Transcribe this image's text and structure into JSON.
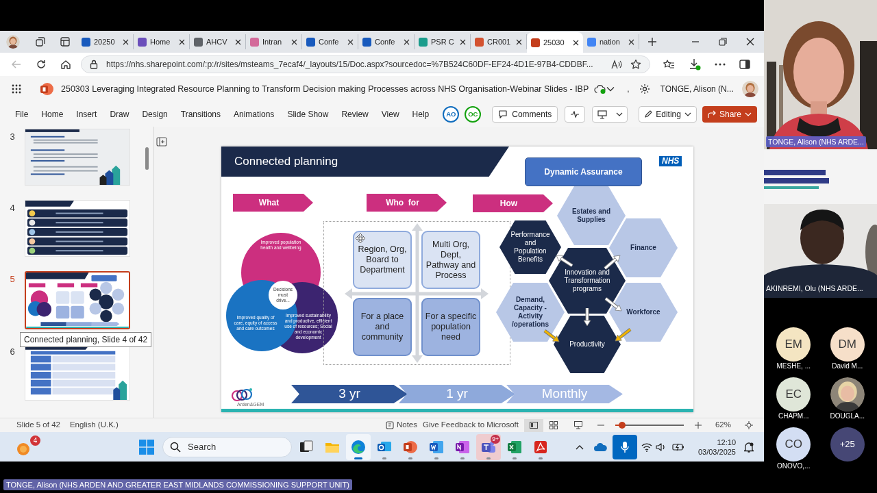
{
  "browser": {
    "tabs": [
      {
        "label": "20250",
        "color": "#185abd",
        "selected": false
      },
      {
        "label": "Home",
        "color": "#6b4fbb",
        "selected": false
      },
      {
        "label": "AHCV",
        "color": "#5f6368",
        "selected": false
      },
      {
        "label": "Intran",
        "color": "#d36a9a",
        "selected": false
      },
      {
        "label": "Confe",
        "color": "#185abd",
        "selected": false
      },
      {
        "label": "Confe",
        "color": "#185abd",
        "selected": false
      },
      {
        "label": "PSR C",
        "color": "#1a9c8c",
        "selected": false
      },
      {
        "label": "CR001",
        "color": "#d35230",
        "selected": false
      },
      {
        "label": "25030",
        "color": "#c43e1c",
        "selected": true
      },
      {
        "label": "nation",
        "color": "#4285f4",
        "selected": false
      }
    ],
    "url": "https://nhs.sharepoint.com/:p:/r/sites/msteams_7ecaf4/_layouts/15/Doc.aspx?sourcedoc=%7B524C60DF-EF24-4D1E-97B4-CDDBF..."
  },
  "app": {
    "document_title": "250303 Leveraging Integrated Resource Planning to Transform  Decision making Processes across NHS Organisation-Webinar Slides - IBP",
    "separator": ",",
    "user_name": "TONGE, Alison (N...",
    "menu": [
      "File",
      "Home",
      "Insert",
      "Draw",
      "Design",
      "Transitions",
      "Animations",
      "Slide Show",
      "Review",
      "View",
      "Help"
    ],
    "coauthors": [
      {
        "initials": "AO",
        "color": "#0f6cbd"
      },
      {
        "initials": "OC",
        "color": "#13a10e"
      }
    ],
    "comments_button": "Comments",
    "editing_button": "Editing",
    "share_button": "Share"
  },
  "thumbnails": [
    {
      "number": "3",
      "kind": "text",
      "selected": false
    },
    {
      "number": "4",
      "kind": "rows",
      "selected": false
    },
    {
      "number": "5",
      "kind": "diagram",
      "selected": true
    },
    {
      "number": "6",
      "kind": "table",
      "selected": false
    }
  ],
  "tooltip": "Connected planning, Slide 4 of 42",
  "slide": {
    "title": "Connected planning",
    "assurance": "Dynamic Assurance",
    "nhs_logo": "NHS",
    "banners": [
      "What",
      "Who  for",
      "How"
    ],
    "venn": [
      "Improved population health and wellbeing",
      "Improved quality of care, equity of access and care outcomes",
      "Improved sustainability and productive, efficient use of resources; Social and economic development"
    ],
    "venn_center": "Decisions must drive...",
    "quadrants": [
      {
        "text": "Region, Org, Board to Department",
        "kind": "light"
      },
      {
        "text": "Multi Org, Dept, Pathway and Process",
        "kind": "light"
      },
      {
        "text": "For a place and community",
        "kind": "mid"
      },
      {
        "text": "For a specific population need",
        "kind": "mid"
      }
    ],
    "hexagons": [
      {
        "text": "Estates and Supplies",
        "kind": "light"
      },
      {
        "text": "Performance and Population Benefits",
        "kind": "dark"
      },
      {
        "text": "Finance",
        "kind": "light"
      },
      {
        "text": "Innovation and Transformation programs",
        "kind": "dark"
      },
      {
        "text": "Demand, Capacity - Activity /operations",
        "kind": "light"
      },
      {
        "text": "Workforce",
        "kind": "light"
      },
      {
        "text": "Productivity",
        "kind": "dark"
      }
    ],
    "timeline": [
      "3 yr",
      "1 yr",
      "Monthly"
    ],
    "logo_text": "Arden&GEM"
  },
  "status_bar": {
    "slide_count": "Slide 5 of 42",
    "language": "English (U.K.)",
    "notes": "Notes",
    "feedback": "Give Feedback to Microsoft",
    "zoom": {
      "level": 0.1
    },
    "zoom_reading": "62%"
  },
  "taskbar": {
    "widget_badge": "4",
    "search_placeholder": "Search",
    "apps": [
      {
        "kind": "task_view",
        "open": false,
        "selected": false
      },
      {
        "kind": "explorer",
        "open": false,
        "selected": false
      },
      {
        "kind": "edge",
        "open": true,
        "selected": true
      },
      {
        "kind": "outlook",
        "open": true,
        "selected": false
      },
      {
        "kind": "powerpoint",
        "open": true,
        "selected": false
      },
      {
        "kind": "word",
        "open": true,
        "selected": false
      },
      {
        "kind": "onenote",
        "open": true,
        "selected": false
      },
      {
        "kind": "teams",
        "open": true,
        "selected": false,
        "badge": "9+"
      },
      {
        "kind": "excel",
        "open": true,
        "selected": false
      },
      {
        "kind": "acrobat",
        "open": true,
        "selected": false
      }
    ],
    "time": "12:10",
    "date": "03/03/2025"
  },
  "participants": {
    "video_tiles": [
      {
        "name": "TONGE, Alison (NHS ARDE..."
      },
      {
        "name": "AKINREMI, Olu (NHS ARDE..."
      }
    ],
    "avatars": [
      {
        "kind": "initials",
        "initials": "EM",
        "name": "MESHE, ...",
        "color": "#f4e5c2"
      },
      {
        "kind": "initials",
        "initials": "DM",
        "name": "David M...",
        "color": "#f6dfc9"
      },
      {
        "kind": "initials",
        "initials": "EC",
        "name": "CHAPM...",
        "color": "#dfe6d8"
      },
      {
        "name": "DOUGLA..."
      },
      {
        "kind": "initials",
        "initials": "CO",
        "name": "ONOVO,...",
        "color": "#d3def3"
      }
    ],
    "overflow": "+25"
  },
  "presenter_label": "TONGE, Alison (NHS ARDEN AND GREATER EAST MIDLANDS COMMISSIONING SUPPORT UNIT)"
}
